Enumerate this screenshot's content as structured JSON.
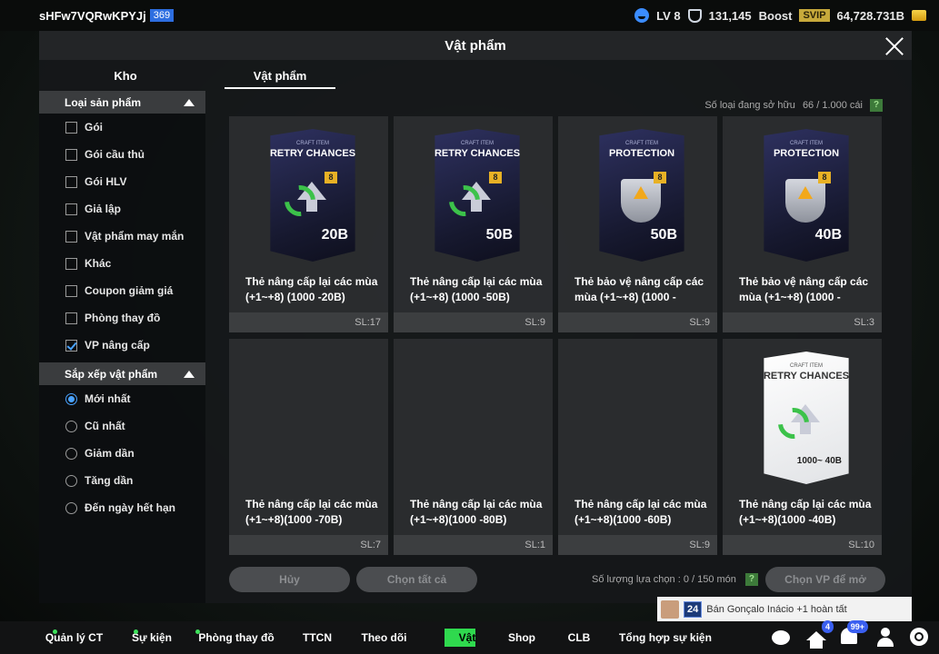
{
  "topbar": {
    "username": "sHFw7VQRwKPYJj",
    "user_level": "369",
    "lv": "LV 8",
    "points": "131,145",
    "boost": "Boost",
    "svip": "SVIP",
    "coins": "64,728.731B"
  },
  "modal": {
    "title": "Vật phẩm",
    "tabs": [
      "Kho",
      "Vật phẩm"
    ],
    "owned_label": "Số loại đang sở hữu",
    "owned_value": "66 / 1.000 cái",
    "help": "?"
  },
  "filter": {
    "title": "Loại sản phẩm",
    "options": [
      {
        "label": "Gói",
        "checked": false
      },
      {
        "label": "Gói cầu thủ",
        "checked": false
      },
      {
        "label": "Gói HLV",
        "checked": false
      },
      {
        "label": "Giả lập",
        "checked": false
      },
      {
        "label": "Vật phẩm may mắn",
        "checked": false
      },
      {
        "label": "Khác",
        "checked": false
      },
      {
        "label": "Coupon giảm giá",
        "checked": false
      },
      {
        "label": "Phòng thay đồ",
        "checked": false
      },
      {
        "label": "VP nâng cấp",
        "checked": true
      }
    ]
  },
  "sort": {
    "title": "Sắp xếp vật phẩm",
    "options": [
      {
        "label": "Mới nhất",
        "checked": true
      },
      {
        "label": "Cũ nhất",
        "checked": false
      },
      {
        "label": "Giảm dần",
        "checked": false
      },
      {
        "label": "Tăng dần",
        "checked": false
      },
      {
        "label": "Đến ngày hết hạn",
        "checked": false
      }
    ]
  },
  "items": [
    {
      "name": "Thẻ nâng cấp lại các mùa (+1~+8) (1000 -20B)",
      "qty": "SL:17",
      "art": "retry",
      "art_small": "CRAFT ITEM",
      "art_title": "RETRY CHANCES",
      "art_badge": "8",
      "art_value": "20B"
    },
    {
      "name": "Thẻ nâng cấp lại các mùa (+1~+8) (1000 -50B)",
      "qty": "SL:9",
      "art": "retry",
      "art_small": "CRAFT ITEM",
      "art_title": "RETRY CHANCES",
      "art_badge": "8",
      "art_value": "50B"
    },
    {
      "name": "Thẻ bảo vệ nâng cấp các mùa (+1~+8) (1000 -",
      "qty": "SL:9",
      "art": "protection",
      "art_small": "CRAFT ITEM",
      "art_title": "PROTECTION",
      "art_badge": "8",
      "art_value": "50B"
    },
    {
      "name": "Thẻ bảo vệ nâng cấp các mùa (+1~+8) (1000 -",
      "qty": "SL:3",
      "art": "protection",
      "art_small": "CRAFT ITEM",
      "art_title": "PROTECTION",
      "art_badge": "8",
      "art_value": "40B"
    },
    {
      "name": "Thẻ nâng cấp lại các mùa (+1~+8)(1000 -70B)",
      "qty": "SL:7",
      "art": "none"
    },
    {
      "name": "Thẻ nâng cấp lại các mùa (+1~+8)(1000 -80B)",
      "qty": "SL:1",
      "art": "none"
    },
    {
      "name": "Thẻ nâng cấp lại các mùa (+1~+8)(1000 -60B)",
      "qty": "SL:9",
      "art": "none"
    },
    {
      "name": "Thẻ nâng cấp lại các mùa (+1~+8)(1000 -40B)",
      "qty": "SL:10",
      "art": "retry-white",
      "art_small": "CRAFT ITEM",
      "art_title": "RETRY CHANCES",
      "art_value": "1000~ 40B"
    }
  ],
  "actions": {
    "cancel": "Hủy",
    "select_all": "Chọn tất cả",
    "selected_label": "Số lượng lựa chọn : 0 / 150 món",
    "help": "?",
    "choose_vp": "Chọn VP để mở"
  },
  "toast": {
    "badge": "24",
    "text": "Bán Gonçalo Inácio +1 hoàn tất"
  },
  "nav": [
    {
      "label": "Quản lý CT",
      "dot": true,
      "active": false
    },
    {
      "label": "Sự kiện",
      "dot": true,
      "active": false
    },
    {
      "label": "Phòng thay đồ",
      "dot": true,
      "active": false
    },
    {
      "label": "TTCN",
      "dot": false,
      "active": false
    },
    {
      "label": "Theo dõi",
      "dot": false,
      "active": false
    },
    {
      "label": "Vật phẩm",
      "dot": false,
      "active": true
    },
    {
      "label": "Shop",
      "dot": false,
      "active": false
    },
    {
      "label": "CLB",
      "dot": false,
      "active": false
    },
    {
      "label": "Tổng hợp sự kiện",
      "dot": false,
      "active": false
    }
  ],
  "nav_badges": {
    "house": "4",
    "bell": "99+"
  }
}
